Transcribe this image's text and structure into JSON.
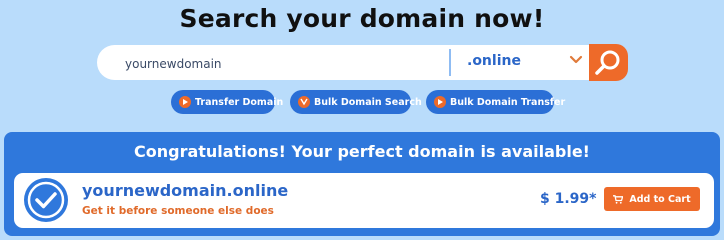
{
  "heading": "Search your domain now!",
  "search": {
    "value": "yournewdomain",
    "tld_selected": ".online",
    "icons": {
      "search": "search-icon",
      "dropdown": "chevron-down-icon"
    }
  },
  "quick_links": [
    {
      "label": "Transfer Domain",
      "icon": "play-icon"
    },
    {
      "label": "Bulk Domain Search",
      "icon": "brand-bulk-search-icon"
    },
    {
      "label": "Bulk Domain Transfer",
      "icon": "play-icon"
    }
  ],
  "result": {
    "headline": "Congratulations! Your perfect domain is available!",
    "domain": "yournewdomain.online",
    "tagline": "Get it before someone else does",
    "price": "$ 1.99*",
    "cart_label": "Add to Cart",
    "icons": {
      "status": "check-circle-icon",
      "cart": "cart-icon"
    }
  },
  "colors": {
    "page_bg": "#b9dcfb",
    "primary_blue": "#2f78dc",
    "accent_orange": "#ee6a29",
    "domain_text": "#2b66c8"
  }
}
